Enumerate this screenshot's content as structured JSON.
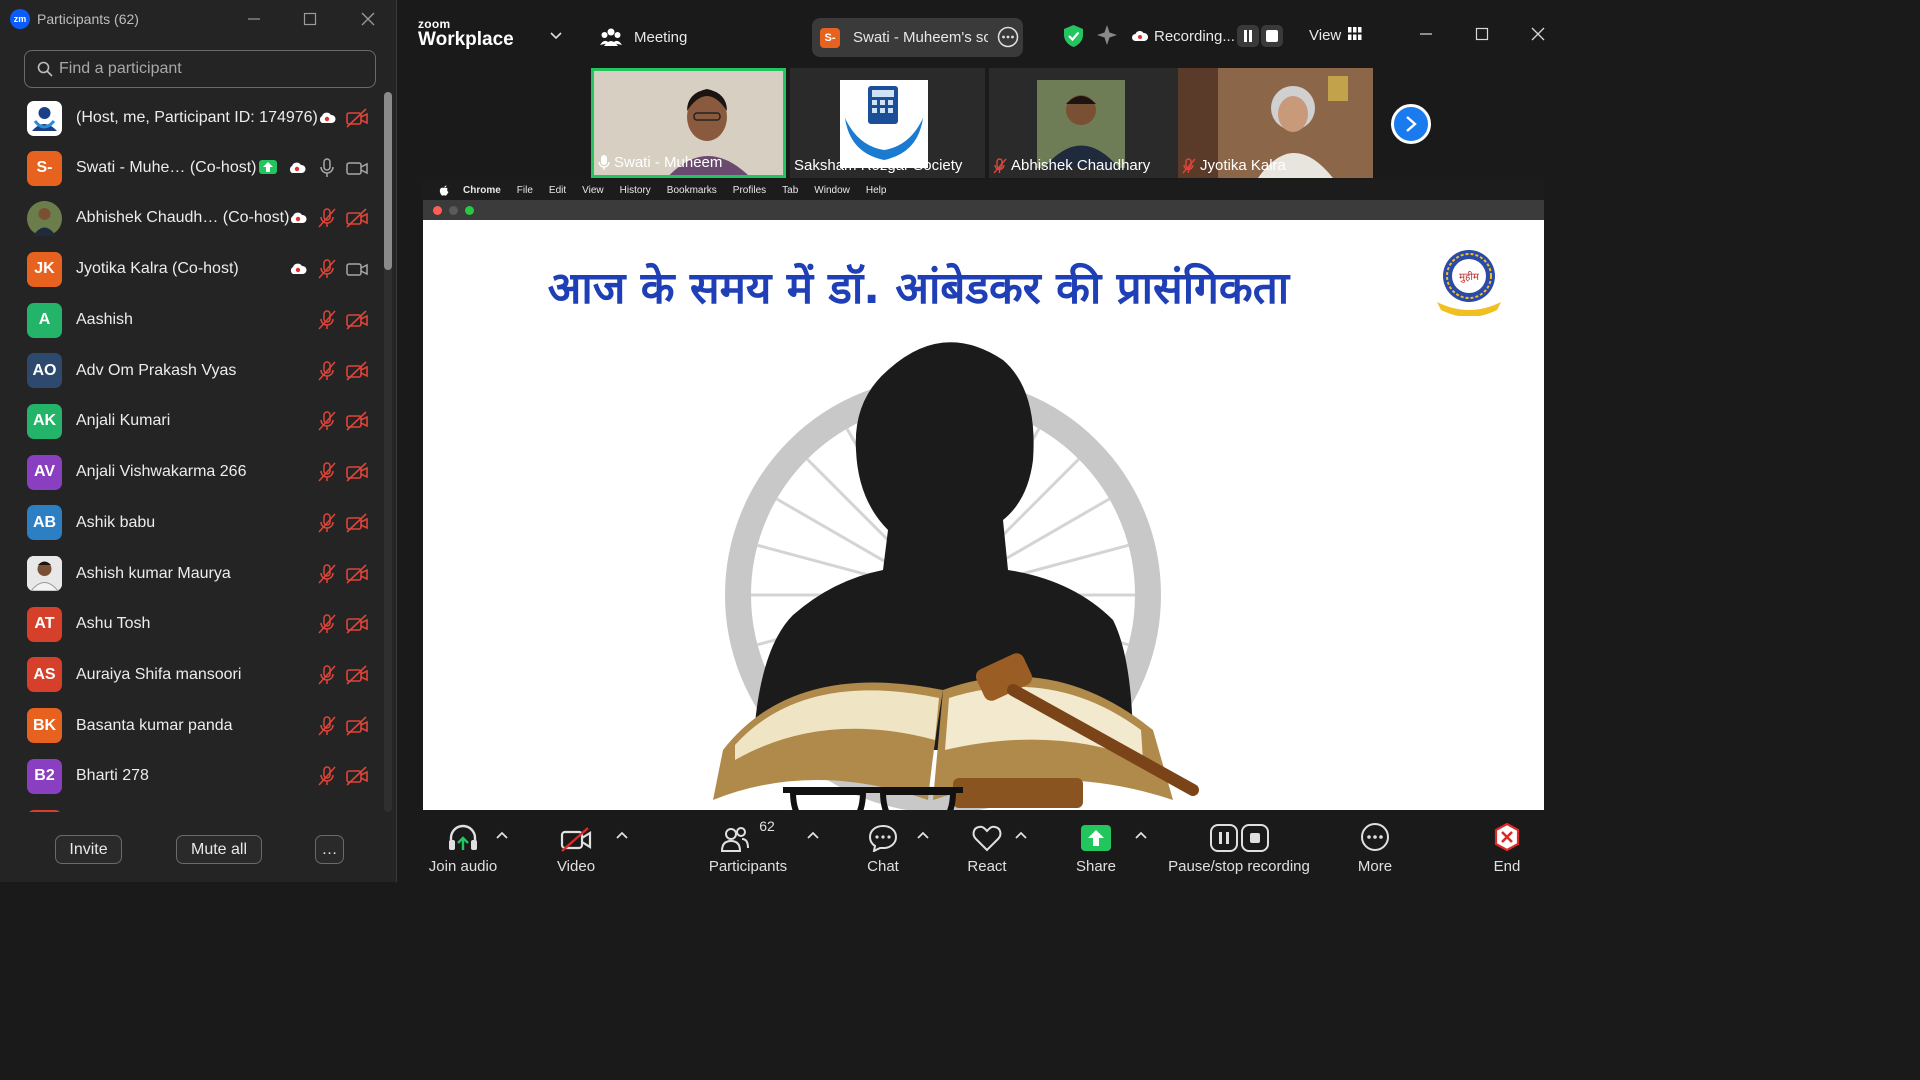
{
  "participants_window": {
    "logo": "zm",
    "title": "Participants (62)",
    "search_placeholder": "Find a participant",
    "invite_label": "Invite",
    "mute_all_label": "Mute all",
    "more_label": "…",
    "items": [
      {
        "initials": "",
        "name": "(Host, me, Participant ID: 174976)",
        "avatar": "image"
      },
      {
        "initials": "S-",
        "name": "Swati - Muhe…  (Co-host)",
        "avatar_color": "#e8621f"
      },
      {
        "initials": "",
        "name": "Abhishek Chaudh…  (Co-host)",
        "avatar": "image"
      },
      {
        "initials": "JK",
        "name": "Jyotika Kalra (Co-host)",
        "avatar_color": "#e8621f"
      },
      {
        "initials": "A",
        "name": "Aashish",
        "avatar_color": "#23b46a"
      },
      {
        "initials": "AO",
        "name": "Adv Om Prakash Vyas",
        "avatar_color": "#2d4a6e"
      },
      {
        "initials": "AK",
        "name": "Anjali Kumari",
        "avatar_color": "#23b46a"
      },
      {
        "initials": "AV",
        "name": "Anjali Vishwakarma 266",
        "avatar_color": "#8a3fc0"
      },
      {
        "initials": "AB",
        "name": "Ashik babu",
        "avatar_color": "#2d7fc4"
      },
      {
        "initials": "",
        "name": "Ashish kumar Maurya",
        "avatar": "image"
      },
      {
        "initials": "AT",
        "name": "Ashu Tosh",
        "avatar_color": "#d6402a"
      },
      {
        "initials": "AS",
        "name": "Auraiya Shifa mansoori",
        "avatar_color": "#d6402a"
      },
      {
        "initials": "BK",
        "name": "Basanta kumar panda",
        "avatar_color": "#e8621f"
      },
      {
        "initials": "B2",
        "name": "Bharti 278",
        "avatar_color": "#8a3fc0"
      }
    ]
  },
  "meeting": {
    "brand_top": "zoom",
    "brand_bottom": "Workplace",
    "meeting_label": "Meeting",
    "share_badge": "S-",
    "share_label": "Swati - Muheem's scr",
    "recording_label": "Recording...",
    "view_label": "View",
    "thumbnails": [
      {
        "name": "Swati - Muheem"
      },
      {
        "name": "Saksham Rozgar Society"
      },
      {
        "name": "Abhishek Chaudhary"
      },
      {
        "name": "Jyotika Kalra"
      }
    ]
  },
  "shared_screen": {
    "menu": [
      "Chrome",
      "File",
      "Edit",
      "View",
      "History",
      "Bookmarks",
      "Profiles",
      "Tab",
      "Window",
      "Help"
    ],
    "slide_title": "आज के समय में डॉ. आंबेडकर की प्रासंगिकता",
    "logo_text": "मुहीम"
  },
  "toolbar": {
    "join_audio": "Join audio",
    "video": "Video",
    "participants": "Participants",
    "participants_count": "62",
    "chat": "Chat",
    "react": "React",
    "share": "Share",
    "pause_stop": "Pause/stop recording",
    "more": "More",
    "end": "End"
  },
  "colors": {
    "accent_blue": "#0b5cff",
    "share_green": "#23c55e",
    "end_red": "#e02828",
    "slide_title": "#1f3fb6"
  }
}
